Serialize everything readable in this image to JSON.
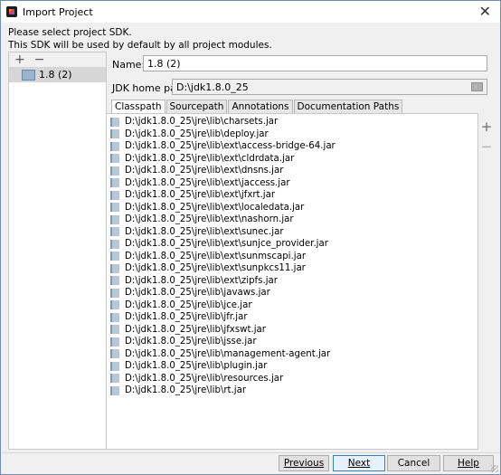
{
  "window": {
    "title": "Import Project"
  },
  "intro": {
    "line1": "Please select project SDK.",
    "line2": "This SDK will be used by default by all project modules."
  },
  "sdk_panel": {
    "add_label": "+",
    "remove_label": "−",
    "items": [
      {
        "label": "1.8 (2)"
      }
    ]
  },
  "form": {
    "name_label": "Name:",
    "name_value": "1.8 (2)",
    "home_label": "JDK home path:",
    "home_value": "D:\\jdk1.8.0_25"
  },
  "tabs": [
    {
      "label": "Classpath",
      "active": true
    },
    {
      "label": "Sourcepath",
      "active": false
    },
    {
      "label": "Annotations",
      "active": false
    },
    {
      "label": "Documentation Paths",
      "active": false
    }
  ],
  "classpath": [
    "D:\\jdk1.8.0_25\\jre\\lib\\charsets.jar",
    "D:\\jdk1.8.0_25\\jre\\lib\\deploy.jar",
    "D:\\jdk1.8.0_25\\jre\\lib\\ext\\access-bridge-64.jar",
    "D:\\jdk1.8.0_25\\jre\\lib\\ext\\cldrdata.jar",
    "D:\\jdk1.8.0_25\\jre\\lib\\ext\\dnsns.jar",
    "D:\\jdk1.8.0_25\\jre\\lib\\ext\\jaccess.jar",
    "D:\\jdk1.8.0_25\\jre\\lib\\ext\\jfxrt.jar",
    "D:\\jdk1.8.0_25\\jre\\lib\\ext\\localedata.jar",
    "D:\\jdk1.8.0_25\\jre\\lib\\ext\\nashorn.jar",
    "D:\\jdk1.8.0_25\\jre\\lib\\ext\\sunec.jar",
    "D:\\jdk1.8.0_25\\jre\\lib\\ext\\sunjce_provider.jar",
    "D:\\jdk1.8.0_25\\jre\\lib\\ext\\sunmscapi.jar",
    "D:\\jdk1.8.0_25\\jre\\lib\\ext\\sunpkcs11.jar",
    "D:\\jdk1.8.0_25\\jre\\lib\\ext\\zipfs.jar",
    "D:\\jdk1.8.0_25\\jre\\lib\\javaws.jar",
    "D:\\jdk1.8.0_25\\jre\\lib\\jce.jar",
    "D:\\jdk1.8.0_25\\jre\\lib\\jfr.jar",
    "D:\\jdk1.8.0_25\\jre\\lib\\jfxswt.jar",
    "D:\\jdk1.8.0_25\\jre\\lib\\jsse.jar",
    "D:\\jdk1.8.0_25\\jre\\lib\\management-agent.jar",
    "D:\\jdk1.8.0_25\\jre\\lib\\plugin.jar",
    "D:\\jdk1.8.0_25\\jre\\lib\\resources.jar",
    "D:\\jdk1.8.0_25\\jre\\lib\\rt.jar"
  ],
  "side_tools": {
    "add": "+",
    "remove": "−"
  },
  "buttons": {
    "previous": "Previous",
    "next": "Next",
    "cancel": "Cancel",
    "help": "Help"
  }
}
